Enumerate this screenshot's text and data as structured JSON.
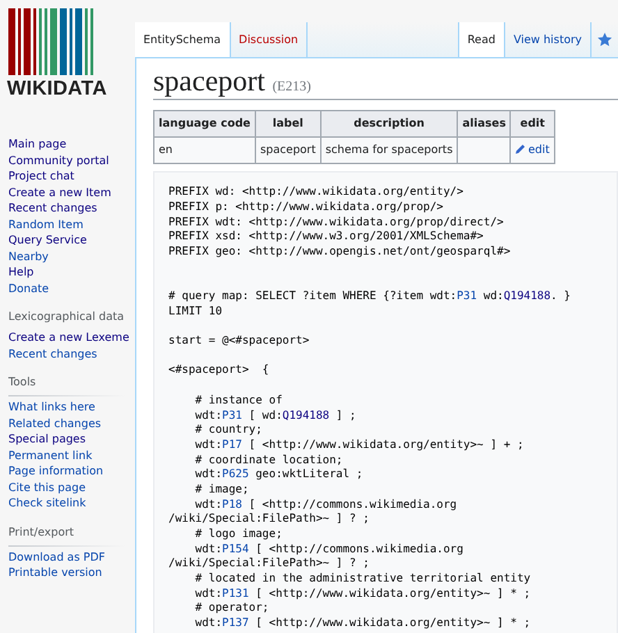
{
  "logo": {
    "text": "WIKIDATA"
  },
  "sidebar": {
    "sections": [
      {
        "items": [
          {
            "label": "Main page",
            "visited": true
          },
          {
            "label": "Community portal",
            "visited": true
          },
          {
            "label": "Project chat",
            "visited": true
          },
          {
            "label": "Create a new Item",
            "visited": true
          },
          {
            "label": "Recent changes",
            "visited": true
          },
          {
            "label": "Random Item",
            "visited": false
          },
          {
            "label": "Query Service",
            "visited": true
          },
          {
            "label": "Nearby",
            "visited": false
          },
          {
            "label": "Help",
            "visited": true
          },
          {
            "label": "Donate",
            "visited": false
          }
        ]
      },
      {
        "heading": "Lexicographical data",
        "items": [
          {
            "label": "Create a new Lexeme",
            "visited": true
          },
          {
            "label": "Recent changes",
            "visited": false
          }
        ]
      },
      {
        "heading": "Tools",
        "items": [
          {
            "label": "What links here",
            "visited": false
          },
          {
            "label": "Related changes",
            "visited": false
          },
          {
            "label": "Special pages",
            "visited": true
          },
          {
            "label": "Permanent link",
            "visited": false
          },
          {
            "label": "Page information",
            "visited": false
          },
          {
            "label": "Cite this page",
            "visited": false
          },
          {
            "label": "Check sitelink",
            "visited": false
          }
        ]
      },
      {
        "heading": "Print/export",
        "items": [
          {
            "label": "Download as PDF",
            "visited": false
          },
          {
            "label": "Printable version",
            "visited": false
          }
        ]
      }
    ]
  },
  "tabs_left": [
    {
      "label": "EntitySchema",
      "selected": true,
      "missing": false
    },
    {
      "label": "Discussion",
      "selected": false,
      "missing": true
    }
  ],
  "tabs_right": [
    {
      "label": "Read",
      "selected": true,
      "kind": "text"
    },
    {
      "label": "View history",
      "selected": false,
      "kind": "text"
    },
    {
      "kind": "star",
      "selected": false
    }
  ],
  "title": {
    "text": "spaceport",
    "id": "(E213)"
  },
  "terms_table": {
    "columns": [
      "language code",
      "label",
      "description",
      "aliases",
      "edit"
    ],
    "rows": [
      {
        "cells": [
          {
            "kind": "text",
            "text": "en"
          },
          {
            "kind": "text",
            "text": "spaceport"
          },
          {
            "kind": "text",
            "text": "schema for spaceports"
          },
          {
            "kind": "empty"
          },
          {
            "kind": "edit",
            "text": "edit"
          }
        ]
      }
    ]
  },
  "code": [
    {
      "kind": "code",
      "parts": [
        {
          "kind": "text",
          "text": "PREFIX wd: <http://www.wikidata.org/entity/>"
        }
      ]
    },
    {
      "kind": "code",
      "parts": [
        {
          "kind": "text",
          "text": "PREFIX p: <http://www.wikidata.org/prop/>"
        }
      ]
    },
    {
      "kind": "code",
      "parts": [
        {
          "kind": "text",
          "text": "PREFIX wdt: <http://www.wikidata.org/prop/direct/>"
        }
      ]
    },
    {
      "kind": "code",
      "parts": [
        {
          "kind": "text",
          "text": "PREFIX xsd: <http://www.w3.org/2001/XMLSchema#>"
        }
      ]
    },
    {
      "kind": "code",
      "parts": [
        {
          "kind": "text",
          "text": "PREFIX geo: <http://www.opengis.net/ont/geosparql#>"
        }
      ]
    },
    {
      "kind": "blank"
    },
    {
      "kind": "blank"
    },
    {
      "kind": "code",
      "parts": [
        {
          "kind": "text",
          "text": "# query map: SELECT ?item WHERE {?item wdt:"
        },
        {
          "kind": "link",
          "text": "P31"
        },
        {
          "kind": "text",
          "text": " wd:"
        },
        {
          "kind": "visited",
          "text": "Q194188"
        },
        {
          "kind": "text",
          "text": ". }"
        }
      ]
    },
    {
      "kind": "code",
      "parts": [
        {
          "kind": "text",
          "text": "LIMIT 10"
        }
      ]
    },
    {
      "kind": "blank"
    },
    {
      "kind": "code",
      "parts": [
        {
          "kind": "text",
          "text": "start = @<#spaceport>"
        }
      ]
    },
    {
      "kind": "blank"
    },
    {
      "kind": "code",
      "parts": [
        {
          "kind": "text",
          "text": "<#spaceport>  {"
        }
      ]
    },
    {
      "kind": "blank"
    },
    {
      "kind": "code",
      "parts": [
        {
          "kind": "text",
          "text": "    # instance of"
        }
      ]
    },
    {
      "kind": "code",
      "parts": [
        {
          "kind": "text",
          "text": "    wdt:"
        },
        {
          "kind": "link",
          "text": "P31"
        },
        {
          "kind": "text",
          "text": " [ wd:"
        },
        {
          "kind": "visited",
          "text": "Q194188"
        },
        {
          "kind": "text",
          "text": " ] ;"
        }
      ]
    },
    {
      "kind": "code",
      "parts": [
        {
          "kind": "text",
          "text": "    # country;"
        }
      ]
    },
    {
      "kind": "code",
      "parts": [
        {
          "kind": "text",
          "text": "    wdt:"
        },
        {
          "kind": "link",
          "text": "P17"
        },
        {
          "kind": "text",
          "text": " [ <http://www.wikidata.org/entity>~ ] + ;"
        }
      ]
    },
    {
      "kind": "code",
      "parts": [
        {
          "kind": "text",
          "text": "    # coordinate location;"
        }
      ]
    },
    {
      "kind": "code",
      "parts": [
        {
          "kind": "text",
          "text": "    wdt:"
        },
        {
          "kind": "link",
          "text": "P625"
        },
        {
          "kind": "text",
          "text": " geo:wktLiteral ;"
        }
      ]
    },
    {
      "kind": "code",
      "parts": [
        {
          "kind": "text",
          "text": "    # image;"
        }
      ]
    },
    {
      "kind": "code",
      "parts": [
        {
          "kind": "text",
          "text": "    wdt:"
        },
        {
          "kind": "link",
          "text": "P18"
        },
        {
          "kind": "text",
          "text": " [ <http://commons.wikimedia.org"
        }
      ]
    },
    {
      "kind": "code",
      "parts": [
        {
          "kind": "text",
          "text": "/wiki/Special:FilePath>~ ] ? ;"
        }
      ]
    },
    {
      "kind": "code",
      "parts": [
        {
          "kind": "text",
          "text": "    # logo image;"
        }
      ]
    },
    {
      "kind": "code",
      "parts": [
        {
          "kind": "text",
          "text": "    wdt:"
        },
        {
          "kind": "link",
          "text": "P154"
        },
        {
          "kind": "text",
          "text": " [ <http://commons.wikimedia.org"
        }
      ]
    },
    {
      "kind": "code",
      "parts": [
        {
          "kind": "text",
          "text": "/wiki/Special:FilePath>~ ] ? ;"
        }
      ]
    },
    {
      "kind": "code",
      "parts": [
        {
          "kind": "text",
          "text": "    # located in the administrative territorial entity"
        }
      ]
    },
    {
      "kind": "code",
      "parts": [
        {
          "kind": "text",
          "text": "    wdt:"
        },
        {
          "kind": "link",
          "text": "P131"
        },
        {
          "kind": "text",
          "text": " [ <http://www.wikidata.org/entity>~ ] * ;"
        }
      ]
    },
    {
      "kind": "code",
      "parts": [
        {
          "kind": "text",
          "text": "    # operator;"
        }
      ]
    },
    {
      "kind": "code",
      "parts": [
        {
          "kind": "text",
          "text": "    wdt:"
        },
        {
          "kind": "link",
          "text": "P137"
        },
        {
          "kind": "text",
          "text": " [ <http://www.wikidata.org/entity>~ ] * ;"
        }
      ]
    }
  ]
}
